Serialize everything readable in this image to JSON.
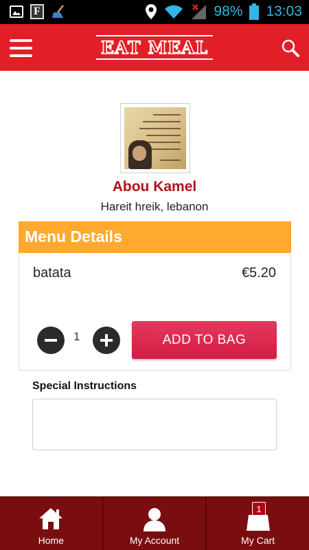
{
  "status_bar": {
    "battery": "98%",
    "time": "13:03",
    "left_icons": [
      "image-icon",
      "app-f-icon",
      "broom-icon"
    ],
    "right_icons": [
      "location-icon",
      "wifi-icon",
      "signal-off-icon",
      "battery-icon"
    ]
  },
  "header": {
    "title": "EAT MEAL",
    "menu_icon": "hamburger-menu-icon",
    "search_icon": "search-icon",
    "background": "#e21f26"
  },
  "restaurant": {
    "name": "Abou Kamel",
    "address": "Hareit hreik, lebanon"
  },
  "menu_details": {
    "title": "Menu Details",
    "header_color": "#ffa930",
    "item": {
      "name": "batata",
      "price": "€5.20",
      "quantity": "1"
    },
    "add_button": "ADD TO BAG",
    "add_button_color": "#d41b44"
  },
  "special_instructions": {
    "label": "Special Instructions",
    "value": "",
    "placeholder": ""
  },
  "bottom_nav": {
    "background": "#7a0d0f",
    "items": [
      {
        "label": "Home",
        "icon": "home-icon"
      },
      {
        "label": "My Account",
        "icon": "user-icon"
      },
      {
        "label": "My Cart",
        "icon": "shopping-bag-icon"
      }
    ],
    "cart_badge": "1"
  }
}
